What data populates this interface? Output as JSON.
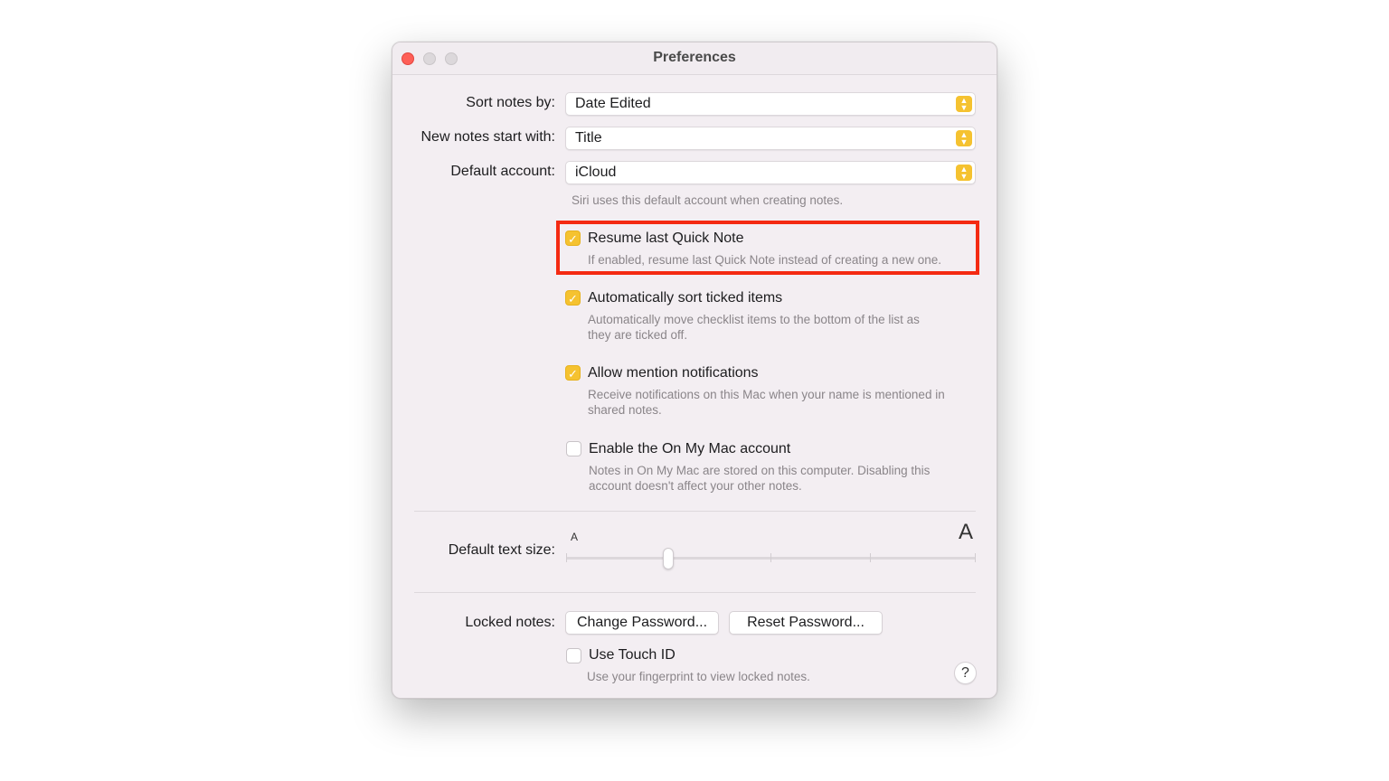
{
  "window": {
    "title": "Preferences"
  },
  "sort": {
    "label": "Sort notes by:",
    "value": "Date Edited"
  },
  "new_notes": {
    "label": "New notes start with:",
    "value": "Title"
  },
  "default_account": {
    "label": "Default account:",
    "value": "iCloud",
    "hint": "Siri uses this default account when creating notes."
  },
  "options": [
    {
      "title": "Resume last Quick Note",
      "desc": "If enabled, resume last Quick Note instead of creating a new one.",
      "checked": true
    },
    {
      "title": "Automatically sort ticked items",
      "desc_line1": "Automatically move checklist items to the bottom of the list as",
      "desc_line2": "they are ticked off.",
      "checked": true
    },
    {
      "title": "Allow mention notifications",
      "desc_line1": "Receive notifications on this Mac when your name is mentioned in",
      "desc_line2": "shared notes.",
      "checked": true
    },
    {
      "title": "Enable the On My Mac account",
      "desc_line1": "Notes in On My Mac are stored on this computer. Disabling this",
      "desc_line2": "account doesn't affect your other notes.",
      "checked": false
    }
  ],
  "text_size": {
    "label": "Default text size:",
    "small_glyph": "A",
    "large_glyph": "A",
    "level_fraction": 0.25
  },
  "locked_notes": {
    "label": "Locked notes:",
    "change_password": "Change Password...",
    "reset_password": "Reset Password...",
    "touch_id_title": "Use Touch ID",
    "touch_id_desc": "Use your fingerprint to view locked notes.",
    "touch_id_checked": false
  },
  "help_glyph": "?",
  "colors": {
    "accent": "#f5c230",
    "highlight": "#f42a12",
    "close": "#fe5f57"
  }
}
